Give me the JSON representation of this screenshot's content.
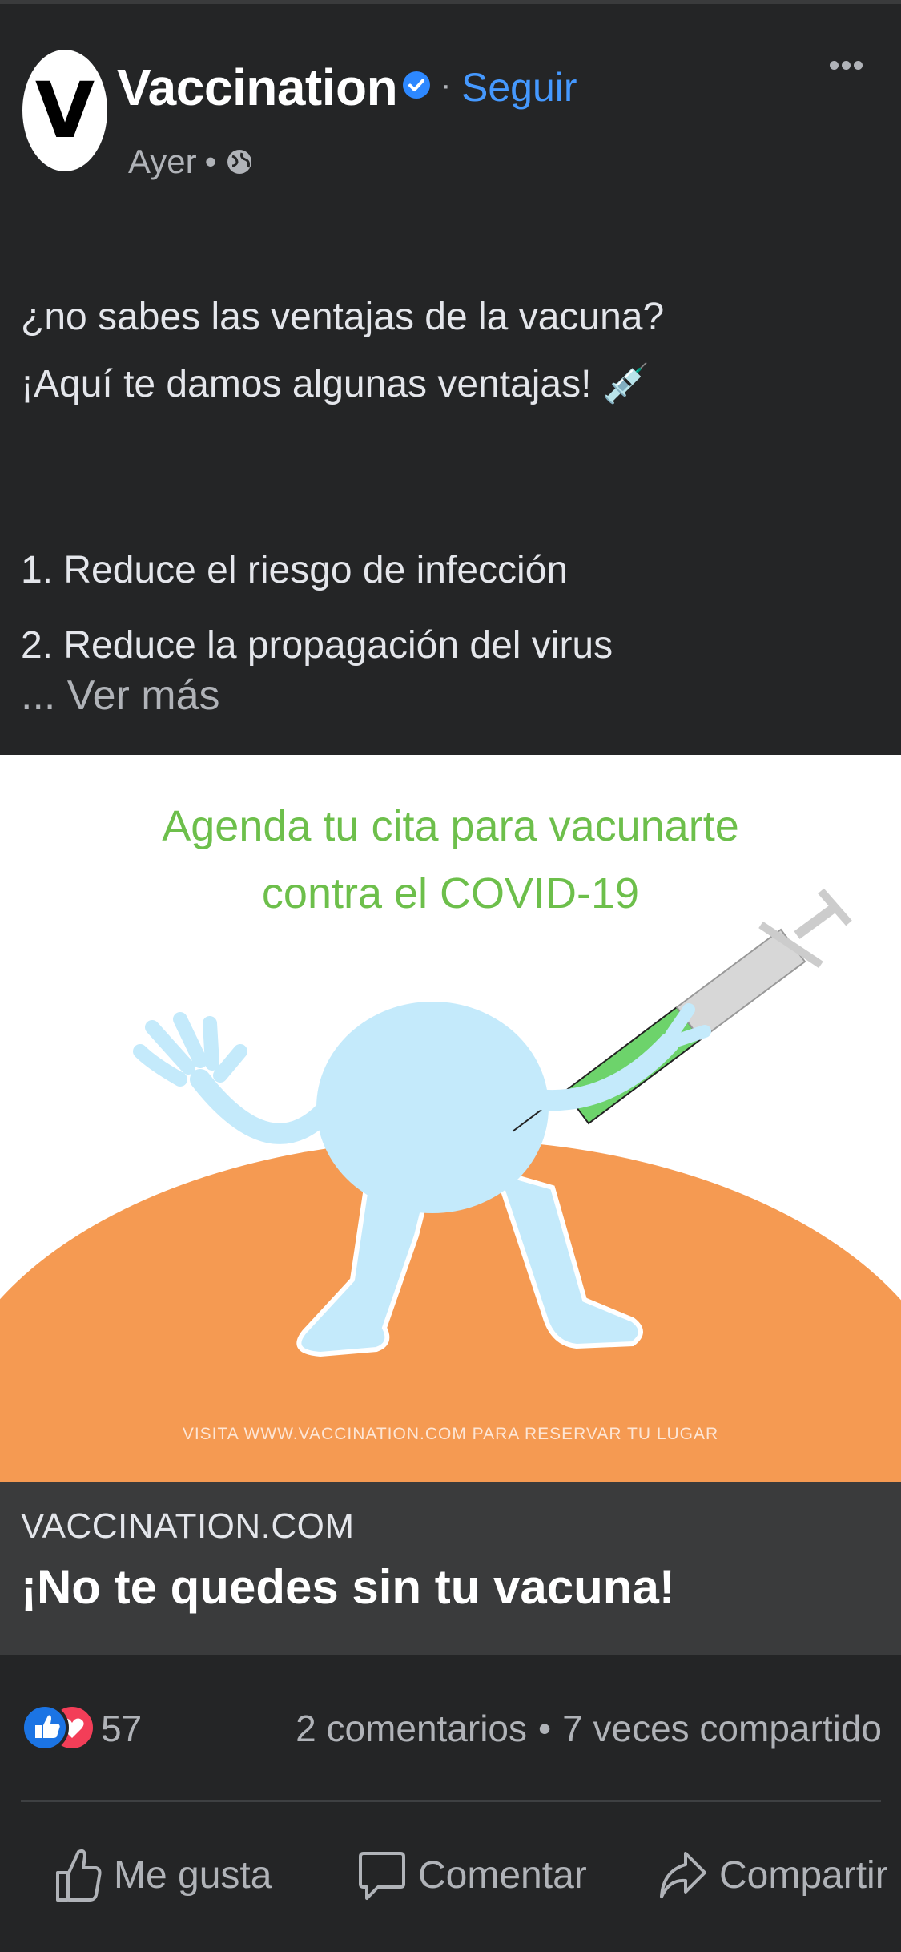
{
  "post": {
    "avatar_letter": "V",
    "page_name": "Vaccination",
    "follow_label": "Seguir",
    "time": "Ayer",
    "text_lines": [
      "¿no sabes las ventajas de la vacuna?",
      "¡Aquí te damos algunas ventajas! 💉",
      "1. Reduce el riesgo de infección",
      "2. Reduce la propagación del virus"
    ],
    "see_more": "... Ver más"
  },
  "image": {
    "headline_line1": "Agenda tu cita para vacunarte",
    "headline_line2": "contra el COVID-19",
    "footer": "VISITA WWW.VACCINATION.COM PARA RESERVAR TU LUGAR"
  },
  "link": {
    "domain": "VACCINATION.COM",
    "title": "¡No te quedes sin tu vacuna!"
  },
  "reactions": {
    "count": "57",
    "comments": "2 comentarios",
    "separator": "•",
    "shares": "7 veces compartido"
  },
  "actions": {
    "like": "Me gusta",
    "comment": "Comentar",
    "share": "Compartir"
  },
  "icons": [
    "verified-icon",
    "more-icon",
    "globe-icon",
    "like-reaction-icon",
    "love-reaction-icon",
    "thumbs-up-icon",
    "comment-icon",
    "share-icon"
  ],
  "colors": {
    "background": "#242526",
    "link_block": "#3a3b3c",
    "accent_blue": "#4599ff",
    "headline_green": "#6dbf4b",
    "hill_orange": "#f59a52",
    "character_blue": "#c4eafb"
  }
}
